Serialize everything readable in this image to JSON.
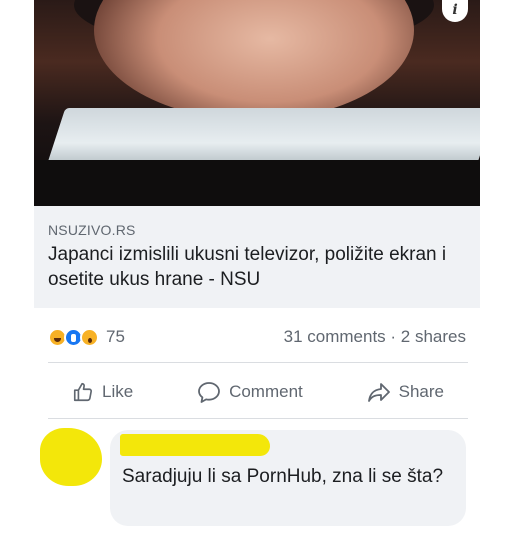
{
  "post": {
    "image_alt_icon": "info-icon",
    "info_label": "i",
    "link": {
      "source": "NSUZIVO.RS",
      "headline": "Japanci izmislili ukusni televizor, poližite ekran i osetite ukus hrane - NSU"
    },
    "reactions": {
      "icons": [
        "haha-reaction-icon",
        "like-reaction-icon",
        "wow-reaction-icon"
      ],
      "count": "75"
    },
    "stats": "31 comments · 2 shares",
    "actions": {
      "like": "Like",
      "comment": "Comment",
      "share": "Share"
    }
  },
  "comment": {
    "text": "Saradjuju li sa PornHub, zna li se šta?"
  },
  "colors": {
    "accent": "#1877f2",
    "redaction": "#f3e70a",
    "muted_text": "#606770"
  }
}
